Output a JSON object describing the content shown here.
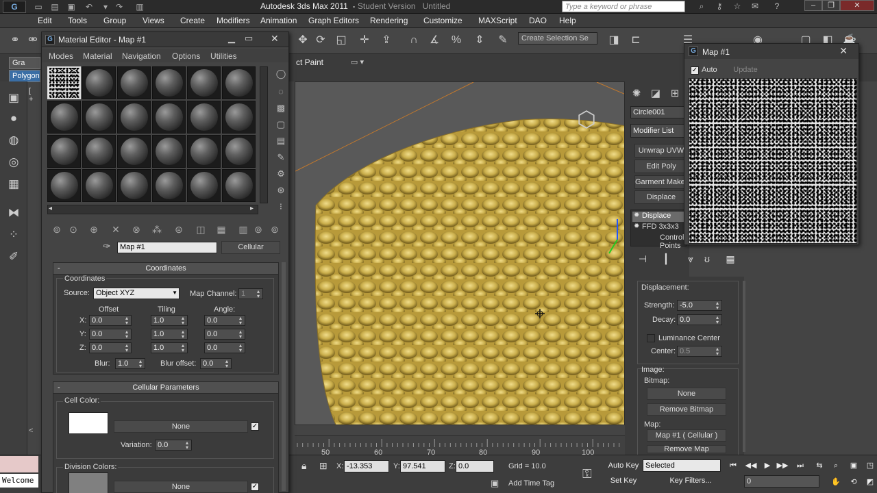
{
  "app": {
    "logo_text": "G",
    "title": "Autodesk 3ds Max 2011",
    "edition": "Student Version",
    "document": "Untitled",
    "search_placeholder": "Type a keyword or phrase"
  },
  "menu": [
    "Edit",
    "Tools",
    "Group",
    "Views",
    "Create",
    "Modifiers",
    "Animation",
    "Graph Editors",
    "Rendering",
    "Customize",
    "MAXScript",
    "DAO",
    "Help"
  ],
  "toolbar": {
    "selection_set": "Create Selection Se"
  },
  "ribbon": {
    "tab1": "Gra",
    "tab2": "Polygon",
    "paint_label": "ct Paint"
  },
  "viewport": {
    "label": "[ +"
  },
  "timeline": {
    "ticks": [
      "50",
      "60",
      "70",
      "80",
      "90",
      "100"
    ]
  },
  "status": {
    "listener": "Welcome",
    "x_label": "X:",
    "x_value": "-13.353",
    "y_label": "Y:",
    "y_value": "97.541",
    "z_label": "Z:",
    "z_value": "0.0",
    "grid": "Grid = 10.0",
    "add_time_tag": "Add Time Tag",
    "auto_key": "Auto Key",
    "set_key": "Set Key",
    "selected": "Selected",
    "key_filters": "Key Filters...",
    "frame": "0"
  },
  "material_editor": {
    "title": "Material Editor - Map #1",
    "menu": [
      "Modes",
      "Material",
      "Navigation",
      "Options",
      "Utilities"
    ],
    "map_name": "Map #1",
    "map_type": "Cellular",
    "coordinates": {
      "header": "Coordinates",
      "group_label": "Coordinates",
      "source_label": "Source:",
      "source_value": "Object XYZ",
      "map_channel_label": "Map Channel:",
      "map_channel_value": "1",
      "offset_label": "Offset",
      "tiling_label": "Tiling",
      "angle_label": "Angle:",
      "x": "X:",
      "y": "Y:",
      "z": "Z:",
      "offset": [
        "0.0",
        "0.0",
        "0.0"
      ],
      "tiling": [
        "1.0",
        "1.0",
        "1.0"
      ],
      "angle": [
        "0.0",
        "0.0",
        "0.0"
      ],
      "blur_label": "Blur:",
      "blur_value": "1.0",
      "blur_offset_label": "Blur offset:",
      "blur_offset_value": "0.0"
    },
    "cellular": {
      "header": "Cellular Parameters",
      "cell_color_label": "Cell Color:",
      "none": "None",
      "variation_label": "Variation:",
      "variation_value": "0.0",
      "division_colors_label": "Division Colors:",
      "cell_color": "#ffffff",
      "division_color": "#808080"
    }
  },
  "command_panel": {
    "object_name": "Circle001",
    "modifier_list": "Modifier List",
    "buttons": [
      "Unwrap UVW",
      "Edit Poly",
      "Garment Maker",
      "Displace"
    ],
    "stack": [
      "Displace",
      "FFD 3x3x3",
      "Control Points"
    ],
    "displacement": {
      "header": "Displacement:",
      "strength_label": "Strength:",
      "strength_value": "-5.0",
      "decay_label": "Decay:",
      "decay_value": "0.0",
      "luminance_label": "Luminance Center",
      "center_label": "Center:",
      "center_value": "0.5",
      "image_label": "Image:",
      "bitmap_label": "Bitmap:",
      "bitmap_button": "None",
      "remove_bitmap": "Remove Bitmap",
      "map_label": "Map:",
      "map_button": "Map #1 ( Cellular )",
      "remove_map": "Remove Map"
    }
  },
  "map_window": {
    "title": "Map #1",
    "auto_label": "Auto",
    "update_label": "Update"
  },
  "colors": {
    "mesh": "#d8c060",
    "accent_blue": "#3a6ea5"
  }
}
